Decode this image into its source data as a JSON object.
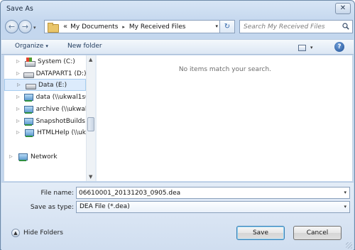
{
  "window": {
    "title": "Save As",
    "close_glyph": "✕"
  },
  "nav": {
    "breadcrumb_prefix": "«",
    "breadcrumb": [
      "My Documents",
      "My Received Files"
    ],
    "separator_glyph": "▸",
    "dropdown_glyph": "▾",
    "refresh_glyph": "↻",
    "search_placeholder": "Search My Received Files"
  },
  "toolbar": {
    "organize_label": "Organize",
    "new_folder_label": "New folder",
    "help_label": "?",
    "dropdown_glyph": "▾"
  },
  "tree": {
    "expander_glyph": "▷",
    "items": [
      {
        "label": "System (C:)",
        "icon": "system-drive-icon",
        "selected": false
      },
      {
        "label": "DATAPART1 (D:)",
        "icon": "drive-icon",
        "selected": false
      },
      {
        "label": "Data (E:)",
        "icon": "drive-icon",
        "selected": true
      },
      {
        "label": "data (\\\\ukwal1s0",
        "icon": "network-drive-icon",
        "selected": false
      },
      {
        "label": "archive (\\\\ukwal1",
        "icon": "network-drive-icon",
        "selected": false
      },
      {
        "label": "SnapshotBuilds (",
        "icon": "network-drive-icon",
        "selected": false
      },
      {
        "label": "HTMLHelp (\\\\uk",
        "icon": "network-drive-icon",
        "selected": false
      }
    ],
    "network_label": "Network"
  },
  "main": {
    "empty_message": "No items match your search."
  },
  "form": {
    "file_name_label": "File name:",
    "file_name_value": "06610001_20131203_0905.dea",
    "save_type_label": "Save as type:",
    "save_type_value": "DEA File (*.dea)"
  },
  "footer": {
    "hide_folders_label": "Hide Folders",
    "save_label": "Save",
    "cancel_label": "Cancel"
  },
  "colors": {
    "selection": "#dcebfc",
    "accent": "#3c7fb1"
  }
}
